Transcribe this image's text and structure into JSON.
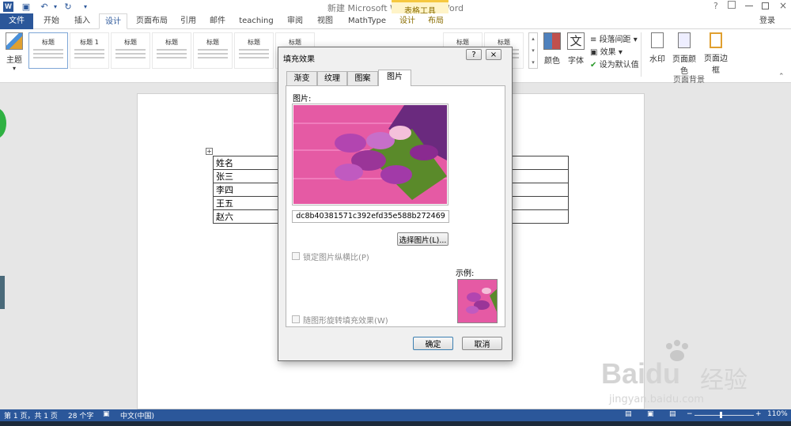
{
  "window": {
    "title": "新建 Microsoft Word 文档 - Word",
    "help": "?",
    "login": "登录"
  },
  "tabs": [
    {
      "label": "文件"
    },
    {
      "label": "开始"
    },
    {
      "label": "插入"
    },
    {
      "label": "设计"
    },
    {
      "label": "页面布局"
    },
    {
      "label": "引用"
    },
    {
      "label": "邮件"
    },
    {
      "label": "teaching"
    },
    {
      "label": "审阅"
    },
    {
      "label": "视图"
    },
    {
      "label": "MathType"
    },
    {
      "label": "设计"
    },
    {
      "label": "布局"
    }
  ],
  "context_group": "表格工具",
  "ribbon": {
    "theme": "主题",
    "style_thumbs": [
      "标题",
      "标题 1",
      "标题",
      "标题",
      "标题",
      "标题",
      "标题",
      "标题",
      "标题",
      "标题",
      "标题",
      "标题"
    ],
    "colors": "颜色",
    "fonts": "字体",
    "para_spacing": "段落间距",
    "effects": "效果",
    "set_default": "设为默认值",
    "watermark": "水印",
    "page_color": "页面颜色",
    "page_border": "页面边框",
    "group_page_bg": "页面背景"
  },
  "doc_table": {
    "names": [
      "姓名",
      "张三",
      "李四",
      "王五",
      "赵六"
    ]
  },
  "dialog": {
    "title": "填充效果",
    "help": "?",
    "close": "×",
    "tabs": [
      "渐变",
      "纹理",
      "图案",
      "图片"
    ],
    "picture_label": "图片:",
    "file_name": "dc8b40381571c392efd35e588b272469",
    "select_button": "选择图片(L)...",
    "lock_aspect": "锁定图片纵横比(P)",
    "sample_label": "示例:",
    "rotate_fill": "随图形旋转填充效果(W)",
    "ok": "确定",
    "cancel": "取消"
  },
  "status": {
    "page": "第 1 页，共 1 页",
    "words": "28 个字",
    "lang": "中文(中国)",
    "zoom": "110%"
  },
  "watermark": {
    "brand": "Bai",
    "brand2": "经验",
    "url": "jingyan.baidu.com"
  },
  "colors": {
    "accent": "#2b579a",
    "context": "#f6c840",
    "pink": "#e65ca8",
    "tulip": "#b245b0"
  }
}
